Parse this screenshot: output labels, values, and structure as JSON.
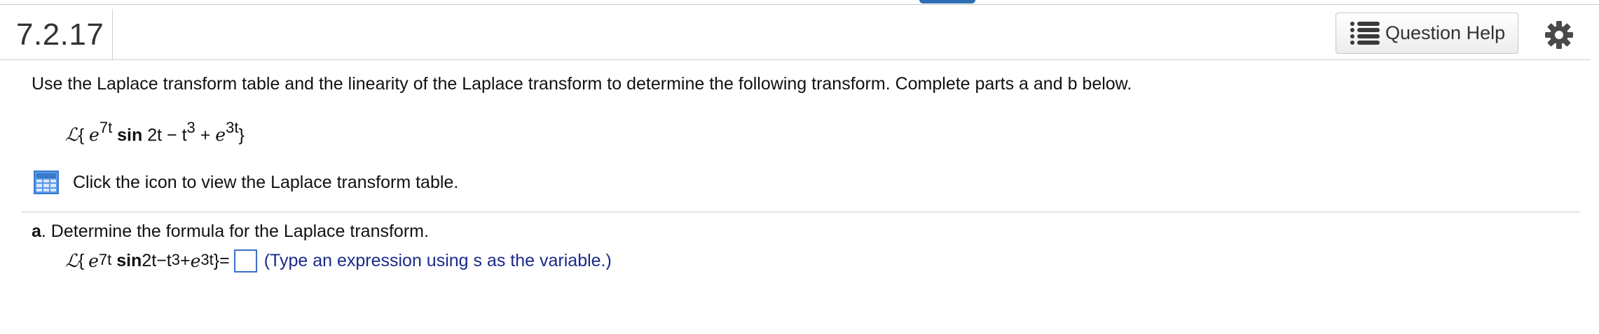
{
  "header": {
    "question_number": "7.2.17",
    "help_button_label": "Question Help",
    "help_icon": "list-icon",
    "settings_icon": "gear-icon"
  },
  "instructions": "Use the Laplace transform table and the linearity of the Laplace transform to determine the following transform. Complete parts a and b below.",
  "expression": {
    "operator": "ℒ",
    "open": "{",
    "e1": "e",
    "exp1": "7t",
    "func": "sin",
    "arg": " 2t",
    "minus": " − ",
    "t": "t",
    "exp2": "3",
    "plus": " + ",
    "e2": "e",
    "exp3": "3t",
    "close": "}"
  },
  "table_link": {
    "icon": "table-icon",
    "text": "Click the icon to view the Laplace transform table."
  },
  "part_a": {
    "label": "a",
    "text": ". Determine the formula for the Laplace transform.",
    "equals": " =",
    "answer_value": "",
    "hint": "(Type an expression using s as the variable.)"
  },
  "colors": {
    "accent": "#3a6fc4",
    "hint_text": "#1a2a8a",
    "top_tab": "#2f6fb5"
  }
}
